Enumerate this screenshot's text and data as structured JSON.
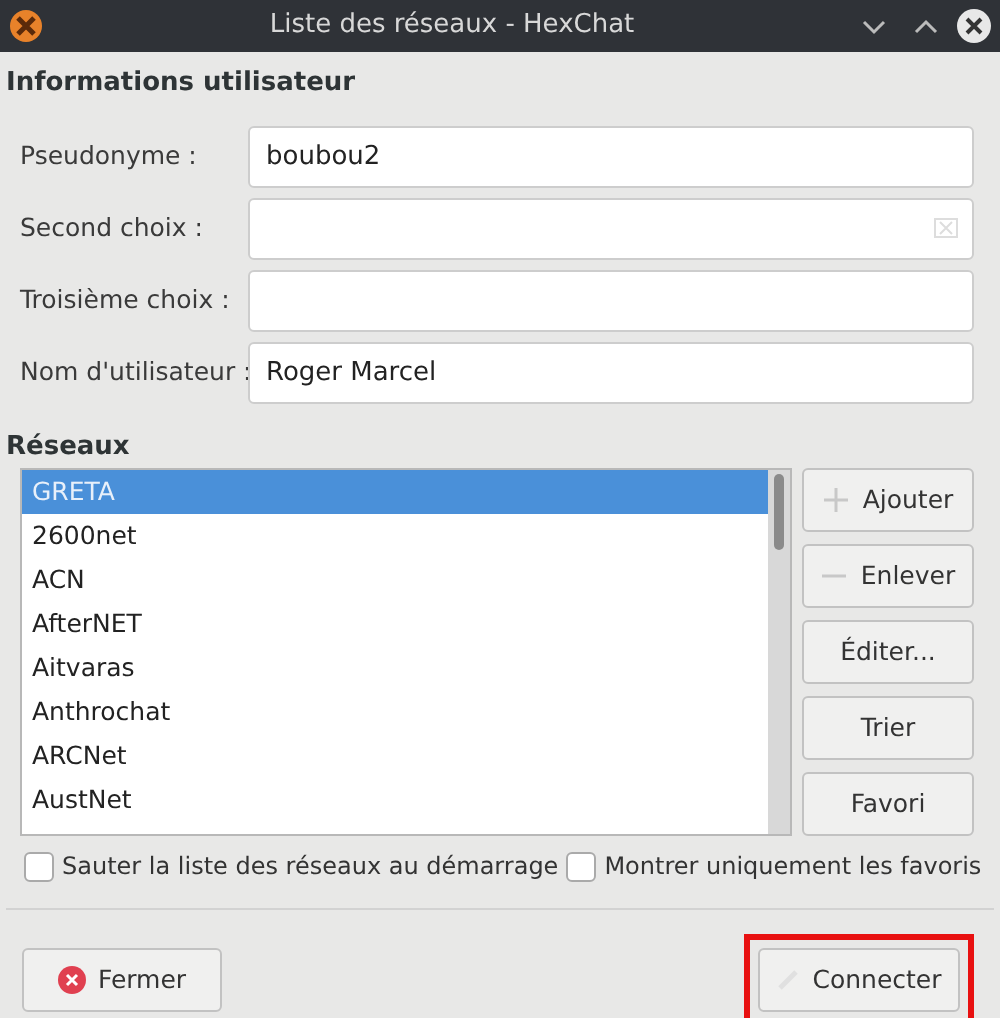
{
  "window": {
    "title": "Liste des réseaux - HexChat"
  },
  "user_info": {
    "heading": "Informations utilisateur",
    "fields": [
      {
        "label": "Pseudonyme :",
        "value": "boubou2",
        "clear_icon": false
      },
      {
        "label": "Second choix :",
        "clear_icon": true
      },
      {
        "label": "Troisième choix :",
        "clear_icon": false
      },
      {
        "label": "Nom d'utilisateur :",
        "value": "Roger Marcel",
        "clear_icon": false
      }
    ]
  },
  "networks": {
    "heading": "Réseaux",
    "items": [
      {
        "name": "GRETA",
        "selected": true
      },
      {
        "name": "2600net",
        "selected": false
      },
      {
        "name": "ACN",
        "selected": false
      },
      {
        "name": "AfterNET",
        "selected": false
      },
      {
        "name": "Aitvaras",
        "selected": false
      },
      {
        "name": "Anthrochat",
        "selected": false
      },
      {
        "name": "ARCNet",
        "selected": false
      },
      {
        "name": "AustNet",
        "selected": false
      }
    ],
    "buttons": [
      {
        "label": "Ajouter",
        "kind": "plus"
      },
      {
        "label": "Enlever",
        "kind": "minus"
      },
      {
        "label": "Éditer...",
        "kind": "plain"
      },
      {
        "label": "Trier",
        "kind": "plain"
      },
      {
        "label": "Favori",
        "kind": "plain"
      }
    ]
  },
  "options": [
    {
      "label": "Sauter la liste des réseaux au démarrage",
      "checked": false
    },
    {
      "label": "Montrer uniquement les favoris",
      "checked": false
    }
  ],
  "footer": {
    "close": "Fermer",
    "connect": "Connecter",
    "connect_highlighted": true
  }
}
